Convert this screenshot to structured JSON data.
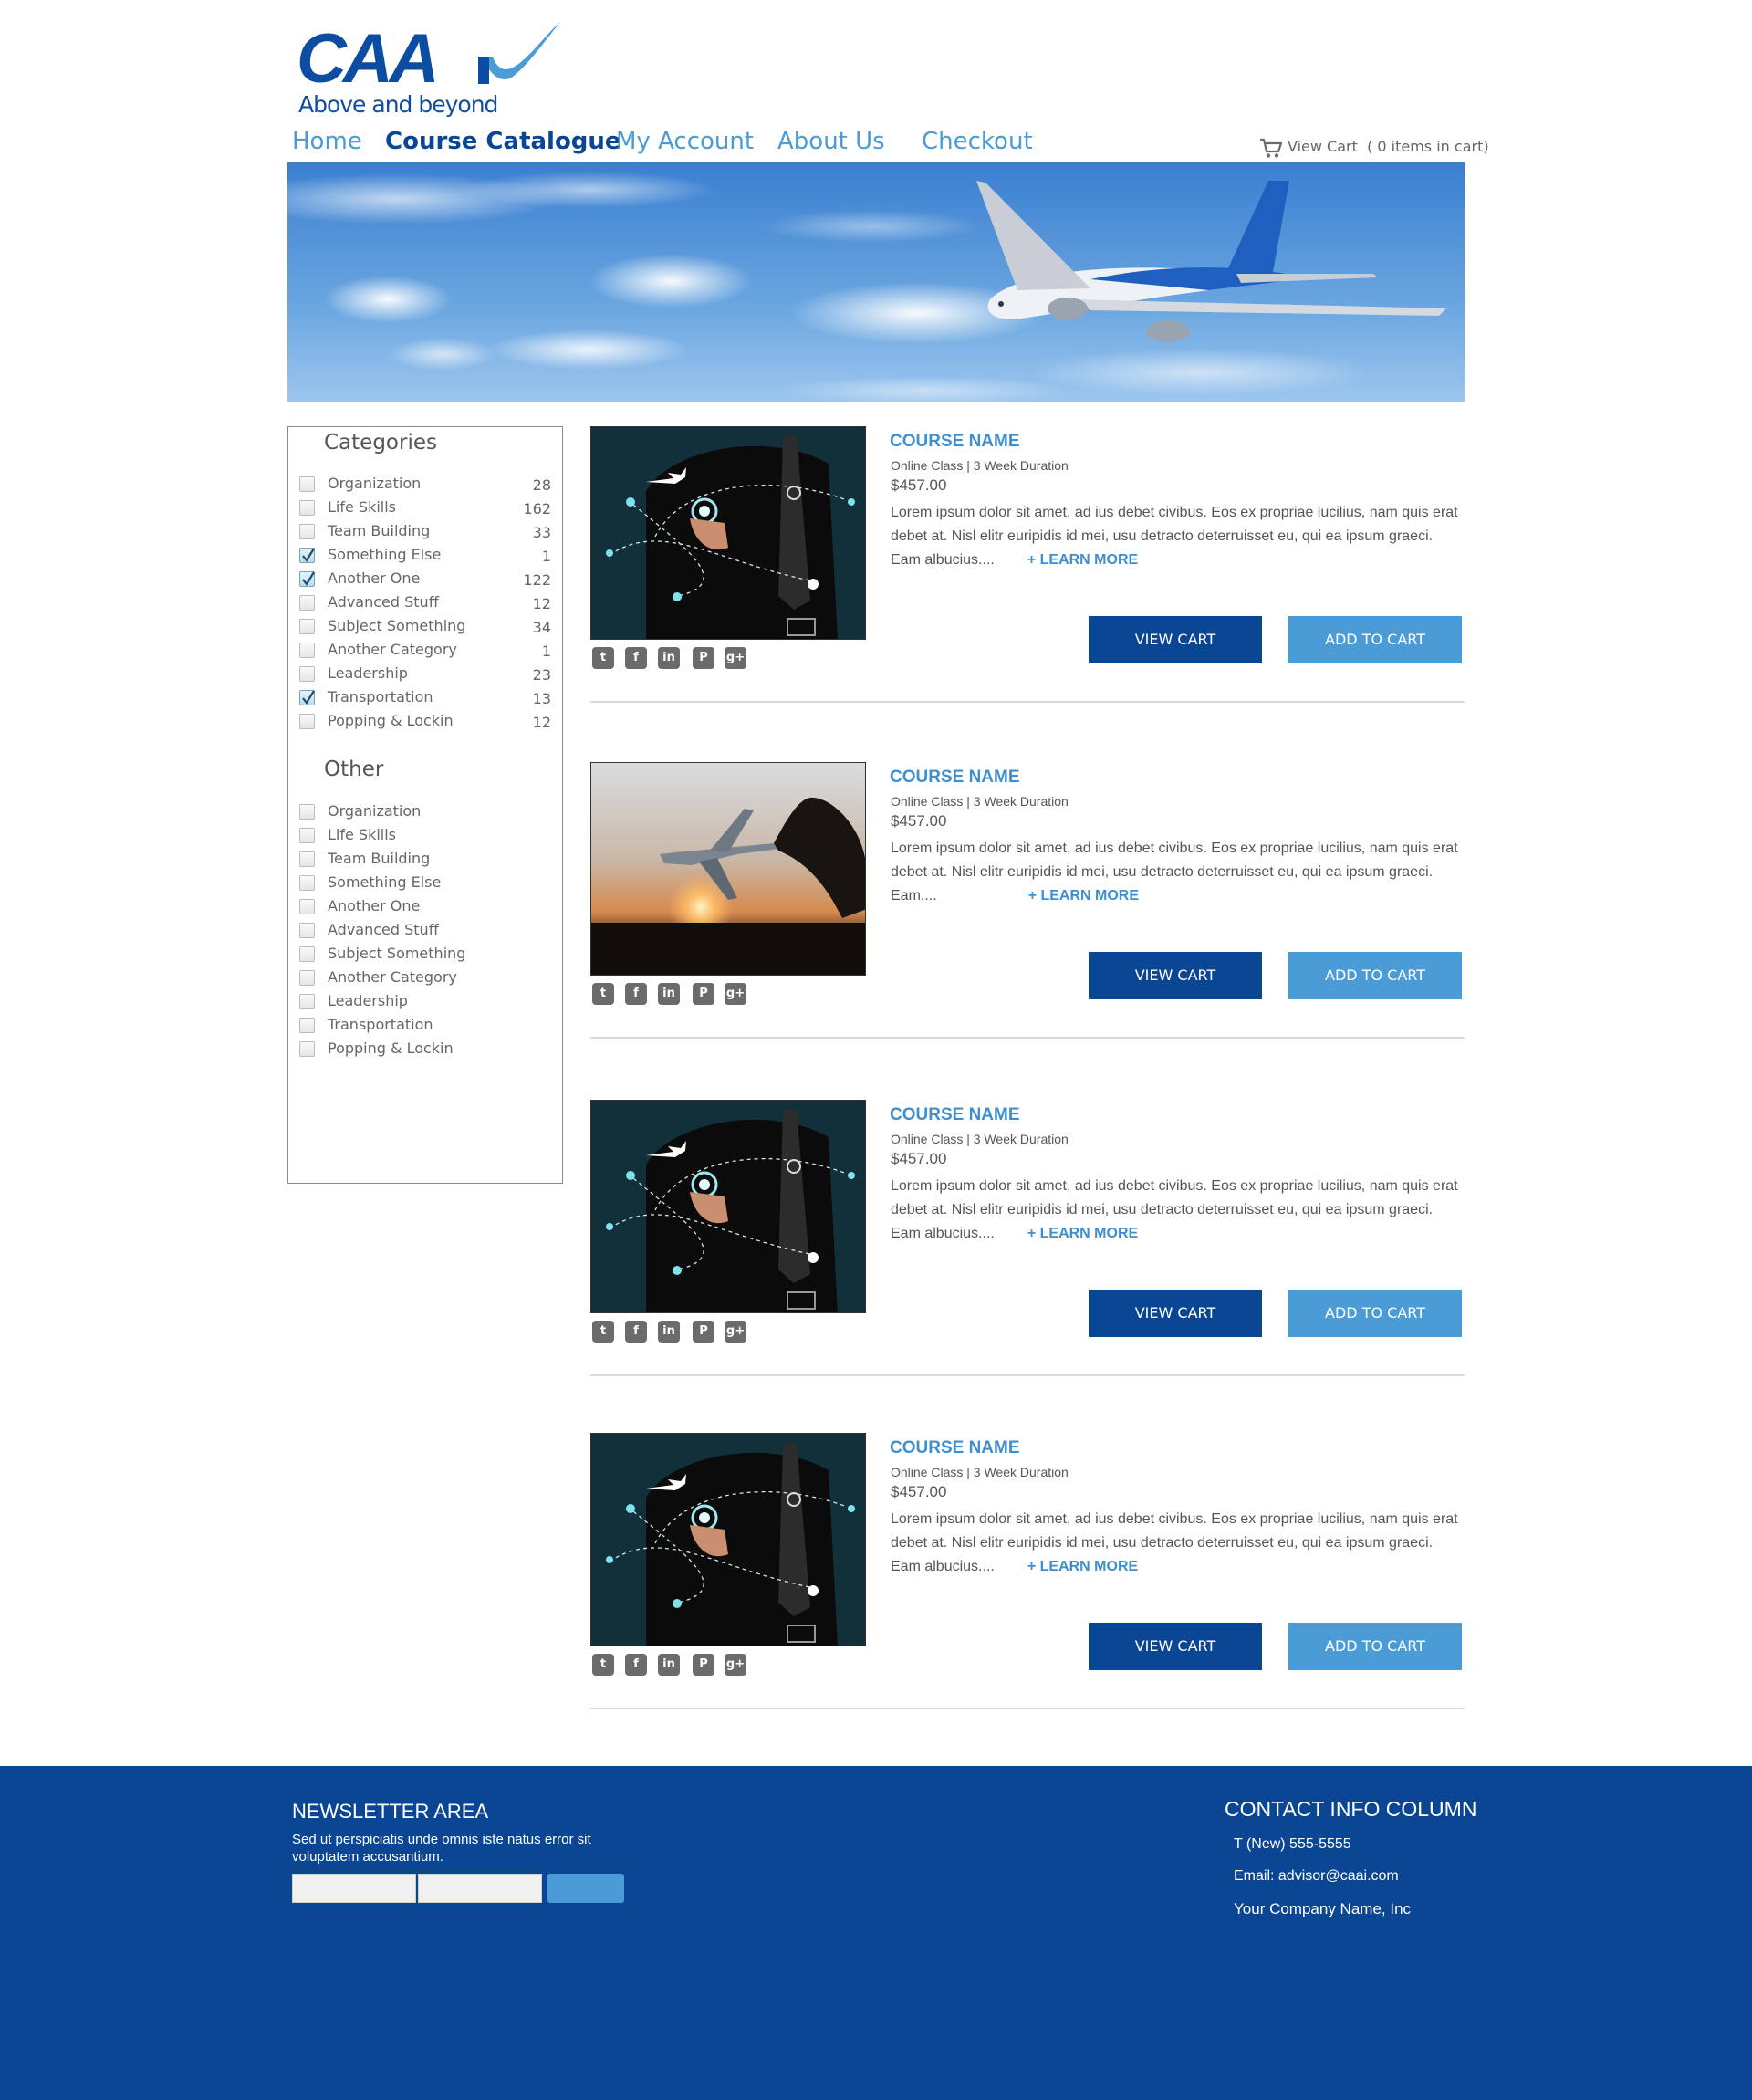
{
  "brand": {
    "logo_text": "CAA",
    "tagline": "Above and beyond",
    "primary_color": "#0a4694",
    "accent_color": "#4a9bd6"
  },
  "nav": {
    "items": [
      {
        "label": "Home",
        "active": false
      },
      {
        "label": "Course Catalogue",
        "active": true
      },
      {
        "label": "My Account",
        "active": false
      },
      {
        "label": "About Us",
        "active": false
      },
      {
        "label": "Checkout",
        "active": false
      }
    ],
    "cart": {
      "label": "View Cart",
      "count_text": "( 0 items in cart)",
      "icon": "cart-icon"
    }
  },
  "sidebar": {
    "categories_heading": "Categories",
    "categories": [
      {
        "label": "Organization",
        "count": "28",
        "checked": false
      },
      {
        "label": "Life Skills",
        "count": "162",
        "checked": false
      },
      {
        "label": "Team Building",
        "count": "33",
        "checked": false
      },
      {
        "label": "Something Else",
        "count": "1",
        "checked": true
      },
      {
        "label": "Another One",
        "count": "122",
        "checked": true
      },
      {
        "label": "Advanced Stuff",
        "count": "12",
        "checked": false
      },
      {
        "label": "Subject Something",
        "count": "34",
        "checked": false
      },
      {
        "label": "Another Category",
        "count": "1",
        "checked": false
      },
      {
        "label": "Leadership",
        "count": "23",
        "checked": false
      },
      {
        "label": "Transportation",
        "count": "13",
        "checked": true
      },
      {
        "label": "Popping & Lockin",
        "count": "12",
        "checked": false
      }
    ],
    "other_heading": "Other",
    "other": [
      {
        "label": "Organization",
        "checked": false
      },
      {
        "label": "Life Skills",
        "checked": false
      },
      {
        "label": "Team Building",
        "checked": false
      },
      {
        "label": "Something Else",
        "checked": false
      },
      {
        "label": "Another One",
        "checked": false
      },
      {
        "label": "Advanced Stuff",
        "checked": false
      },
      {
        "label": "Subject Something",
        "checked": false
      },
      {
        "label": "Another Category",
        "checked": false
      },
      {
        "label": "Leadership",
        "checked": false
      },
      {
        "label": "Transportation",
        "checked": false
      },
      {
        "label": "Popping & Lockin",
        "checked": false
      }
    ]
  },
  "products": [
    {
      "name": "COURSE NAME",
      "meta": "Online Class | 3 Week Duration",
      "price": "$457.00",
      "description": "Lorem ipsum dolor sit amet, ad ius debet civibus. Eos ex propriae lucilius, nam quis erat debet at. Nisl elitr euripidis id mei, usu detracto deterruisset eu, qui ea ipsum graeci. Eam albucius....",
      "learn_more": "+ LEARN MORE",
      "image": "businessman-network-image",
      "view_cart": "VIEW CART",
      "add_to_cart": "ADD TO CART"
    },
    {
      "name": "COURSE NAME",
      "meta": "Online Class | 3 Week Duration",
      "price": "$457.00",
      "description": "Lorem ipsum dolor sit amet, ad ius debet civibus. Eos ex propriae lucilius, nam quis erat debet at. Nisl elitr euripidis id mei, usu detracto deterruisset eu, qui ea ipsum graeci. Eam....",
      "learn_more": "+ LEARN MORE",
      "image": "toy-plane-sunset-image",
      "view_cart": "VIEW CART",
      "add_to_cart": "ADD TO CART"
    },
    {
      "name": "COURSE NAME",
      "meta": "Online Class | 3 Week Duration",
      "price": "$457.00",
      "description": "Lorem ipsum dolor sit amet, ad ius debet civibus. Eos ex propriae lucilius, nam quis erat debet at. Nisl elitr euripidis id mei, usu detracto deterruisset eu, qui ea ipsum graeci. Eam albucius....",
      "learn_more": "+ LEARN MORE",
      "image": "businessman-network-image",
      "view_cart": "VIEW CART",
      "add_to_cart": "ADD TO CART"
    },
    {
      "name": "COURSE NAME",
      "meta": "Online Class | 3 Week Duration",
      "price": "$457.00",
      "description": "Lorem ipsum dolor sit amet, ad ius debet civibus. Eos ex propriae lucilius, nam quis erat debet at. Nisl elitr euripidis id mei, usu detracto deterruisset eu, qui ea ipsum graeci. Eam albucius....",
      "learn_more": "+ LEARN MORE",
      "image": "businessman-network-image",
      "view_cart": "VIEW CART",
      "add_to_cart": "ADD TO CART"
    }
  ],
  "social_icons": [
    "twitter-icon",
    "facebook-icon",
    "linkedin-icon",
    "pinterest-icon",
    "google-plus-icon"
  ],
  "footer": {
    "newsletter_title": "NEWSLETTER AREA",
    "newsletter_text": "Sed ut perspiciatis unde omnis iste natus error sit voluptatem accusantium.",
    "contact_title": "CONTACT INFO COLUMN",
    "phone": "T (New) 555-5555",
    "email": "Email: advisor@caai.com",
    "company": "Your Company Name, Inc"
  }
}
